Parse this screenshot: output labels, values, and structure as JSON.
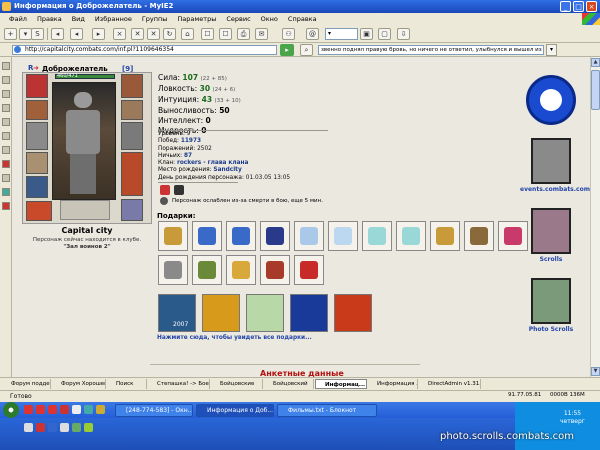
{
  "window": {
    "title": "Информация о Доброжелатель - MyIE2"
  },
  "menu": [
    "Файл",
    "Правка",
    "Вид",
    "Избранное",
    "Группы",
    "Параметры",
    "Сервис",
    "Окно",
    "Справка"
  ],
  "address": {
    "url": "http://capitalcity.combats.com/inf.pl?1109646354",
    "message": "звенно поднял правую бровь, но ничего не ответил, улыбнулся и вышел из кл"
  },
  "character": {
    "name": "Доброжелатель",
    "level": "[9]",
    "hp": "460/471",
    "city": "Capital city",
    "location_line1": "Персонаж сейчас находится в клубе.",
    "location_line2": "\"Зал воинов 2\""
  },
  "stats": [
    {
      "label": "Сила:",
      "value": "107",
      "bonus": "(22 + 85)"
    },
    {
      "label": "Ловкость:",
      "value": "30",
      "bonus": "(24 + 6)"
    },
    {
      "label": "Интуиция:",
      "value": "43",
      "bonus": "(33 + 10)"
    },
    {
      "label": "Выносливость:",
      "value": "50",
      "bonus": ""
    },
    {
      "label": "Интеллект:",
      "value": "0",
      "bonus": ""
    },
    {
      "label": "Мудрость:",
      "value": "0",
      "bonus": ""
    }
  ],
  "info": [
    {
      "label": "Уровень:",
      "value": "9"
    },
    {
      "label": "Побед:",
      "value": "11973"
    },
    {
      "label": "Поражений:",
      "value": "2502"
    },
    {
      "label": "Ничьих:",
      "value": "87"
    },
    {
      "label": "Клан:",
      "value": "rockers - глава клана"
    },
    {
      "label": "Место рождения:",
      "value": "Sandcity"
    },
    {
      "label": "День рождения персонажа:",
      "value": "01.03.05 13:05"
    }
  ],
  "weakened": "Персонаж ослаблен из-за смерти в бою, еще 5 мин.",
  "gifts": {
    "label": "Подарки:",
    "link": "Нажмите сюда, чтобы увидеть все подарки...",
    "colors_row1": [
      "#c89a3a",
      "#3a6ac8",
      "#3a6ac8",
      "#2a3a8a",
      "#aac8e8",
      "#bcd8f0",
      "#9ad8d8",
      "#9ad8d8",
      "#c89a3a",
      "#8a6a3a",
      "#c83a6a"
    ],
    "colors_row2": [
      "#8a8a8a",
      "#6a8a3a",
      "#d8a83a",
      "#a83a2a",
      "#c82a2a"
    ],
    "cards": [
      "#2a5a8a",
      "#d89a1a",
      "#b8d8a8",
      "#1a3a9a",
      "#c83a1a"
    ],
    "card_year": "2007"
  },
  "banners": [
    {
      "label": "events.combats.com"
    },
    {
      "label": "Scrolls"
    },
    {
      "label": "Photo Scrolls"
    }
  ],
  "section_title": "Анкетные данные",
  "tabs": [
    "Форум подде...",
    "Форум Хорошег...",
    "Поиск",
    "Степашка! -> Бое...",
    "Бойцовские ",
    "Бойцовский",
    "Информац...",
    "Информация ... ",
    "DirectAdmin v1.31.5"
  ],
  "status": {
    "text": "Готово",
    "stats": "91.77.05.81",
    "mem": "0000B 136M"
  },
  "taskbar": {
    "tasks": [
      "[248-774-583] - Окн...",
      "Информация о Доб...",
      "Фильмы.txt - Блокнот"
    ],
    "time": "11:55",
    "day": "четверг"
  },
  "watermark": "photo.scrolls.combats.com"
}
